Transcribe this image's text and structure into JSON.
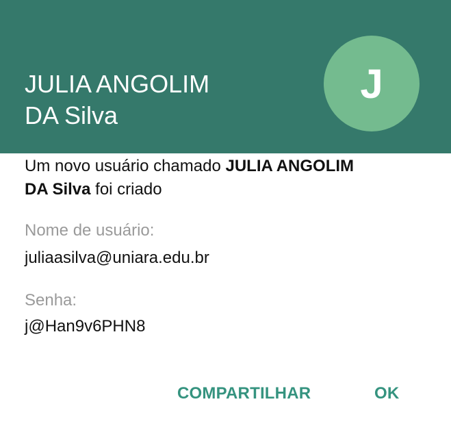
{
  "header": {
    "name_line1": "JULIA ANGOLIM",
    "name_line2": "DA Silva",
    "avatar_initial": "J",
    "background_color": "#35796b",
    "avatar_color": "#74bb8f"
  },
  "message": {
    "prefix": "Um novo usuário chamado ",
    "name_bold_line1": "JULIA ANGOLIM",
    "name_bold_line2": "DA Silva",
    "suffix": " foi criado"
  },
  "fields": {
    "username_label": "Nome de usuário:",
    "username_value": "juliaasilva@uniara.edu.br",
    "password_label": "Senha:",
    "password_value": "j@Han9v6PHN8"
  },
  "actions": {
    "share_label": "COMPARTILHAR",
    "ok_label": "OK",
    "accent_color": "#35937f"
  }
}
